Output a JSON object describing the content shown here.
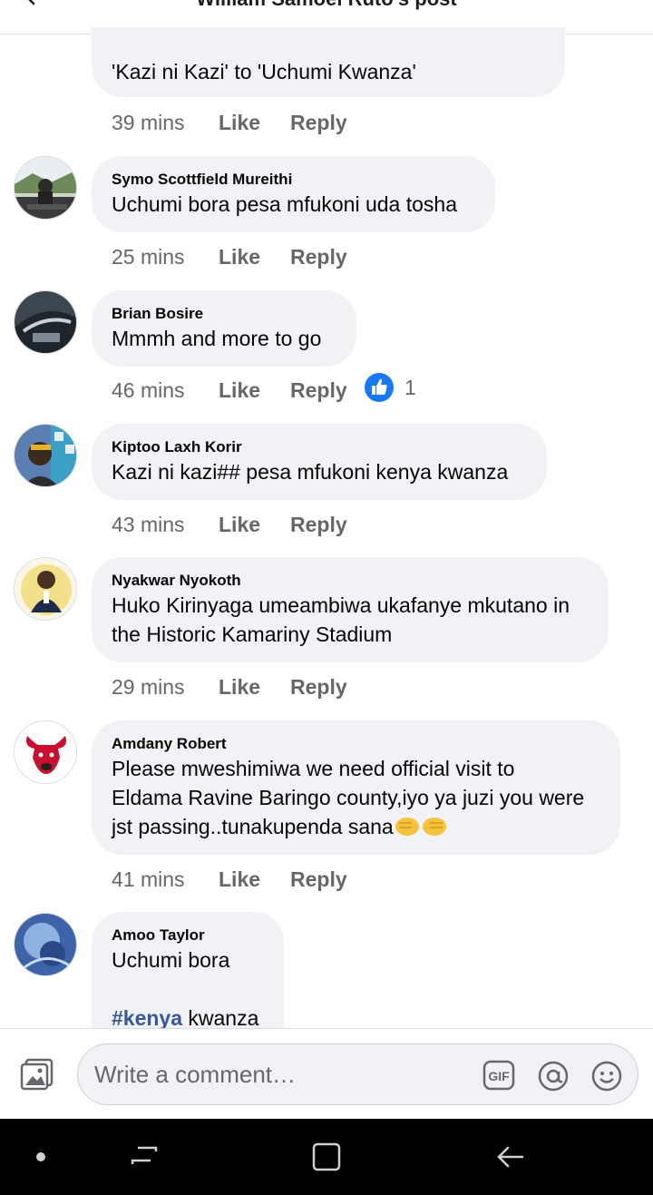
{
  "header": {
    "title": "William Samoei Ruto's post"
  },
  "comments": [
    {
      "author": "",
      "text": "'Kazi ni Kazi' to 'Uchumi Kwanza'",
      "time": "39 mins"
    },
    {
      "author": "Symo Scottfield Mureithi",
      "text": "Uchumi bora pesa mfukoni uda tosha",
      "time": "25 mins"
    },
    {
      "author": "Brian Bosire",
      "text": "Mmmh and more to go",
      "time": "46 mins",
      "reactions": "1"
    },
    {
      "author": "Kiptoo Laxh Korir",
      "text": "Kazi ni kazi## pesa mfukoni kenya kwanza",
      "time": "43 mins"
    },
    {
      "author": "Nyakwar Nyokoth",
      "text": "Huko Kirinyaga umeambiwa ukafanye mkutano in\nthe Historic Kamariny Stadium",
      "time": "29 mins"
    },
    {
      "author": "Amdany Robert",
      "text": "Please mweshimiwa we need official visit to\nEldama Ravine Baringo county,iyo ya juzi you were\njst passing..tunakupenda sana",
      "time": "41 mins"
    },
    {
      "author": "Amoo Taylor",
      "text_line1": "Uchumi bora",
      "hashtag": "#kenya",
      "text_after_hashtag": " kwanza"
    }
  ],
  "actions": {
    "like": "Like",
    "reply": "Reply"
  },
  "composer": {
    "placeholder": "Write a comment…",
    "gif_label": "GIF"
  },
  "icons": [
    "back-arrow-icon",
    "thumbs-up-icon",
    "photo-icon",
    "gif-icon",
    "at-icon",
    "smiley-icon",
    "nav-dot-icon",
    "recent-apps-icon",
    "home-icon",
    "back-icon"
  ],
  "colors": {
    "bubble": "#f0f2f5",
    "link": "#385898",
    "like_blue": "#1877f2",
    "meta": "#65676b"
  }
}
